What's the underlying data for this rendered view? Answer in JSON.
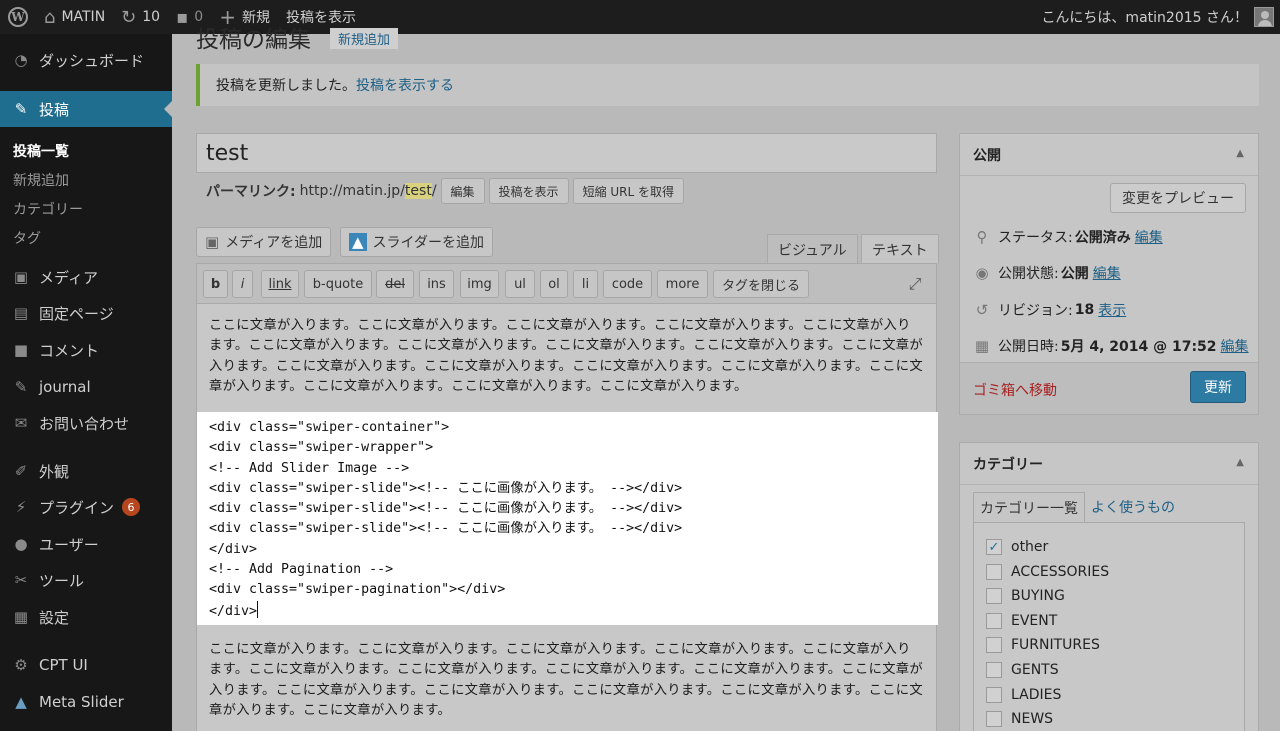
{
  "admin_bar": {
    "site_name": "MATIN",
    "updates_count": "10",
    "comments_count": "0",
    "new_label": "新規",
    "view_post_label": "投稿を表示",
    "greeting": "こんにちは、matin2015 さん！"
  },
  "sidebar": {
    "dashboard": "ダッシュボード",
    "posts": "投稿",
    "posts_sub": [
      "投稿一覧",
      "新規追加",
      "カテゴリー",
      "タグ"
    ],
    "media": "メディア",
    "pages": "固定ページ",
    "comments": "コメント",
    "journal": "journal",
    "contact": "お問い合わせ",
    "appearance": "外観",
    "plugins": "プラグイン",
    "plugins_badge": "6",
    "users": "ユーザー",
    "tools": "ツール",
    "settings": "設定",
    "cpt_ui": "CPT UI",
    "meta_slider": "Meta Slider"
  },
  "page": {
    "title": "投稿の編集",
    "add_new": "新規追加"
  },
  "notice": {
    "text": "投稿を更新しました。",
    "link": "投稿を表示する"
  },
  "editor": {
    "post_title": "test",
    "permalink_label": "パーマリンク:",
    "permalink_base": "http://matin.jp/",
    "permalink_slug": "test",
    "permalink_end": "/",
    "edit_btn": "編集",
    "view_btn": "投稿を表示",
    "shortlink_btn": "短縮 URL を取得",
    "add_media": "メディアを追加",
    "add_slider": "スライダーを追加",
    "tab_visual": "ビジュアル",
    "tab_text": "テキスト",
    "quicktags": [
      "b",
      "i",
      "link",
      "b-quote",
      "del",
      "ins",
      "img",
      "ul",
      "ol",
      "li",
      "code",
      "more",
      "タグを閉じる"
    ],
    "para1": "ここに文章が入ります。ここに文章が入ります。ここに文章が入ります。ここに文章が入ります。ここに文章が入ります。ここに文章が入ります。ここに文章が入ります。ここに文章が入ります。ここに文章が入ります。ここに文章が入ります。ここに文章が入ります。ここに文章が入ります。ここに文章が入ります。ここに文章が入ります。ここに文章が入ります。ここに文章が入ります。ここに文章が入ります。ここに文章が入ります。",
    "code_lines": [
      "<div class=\"swiper-container\">",
      "<div class=\"swiper-wrapper\">",
      "<!-- Add Slider Image -->",
      "<div class=\"swiper-slide\"><!-- ここに画像が入ります。 --></div>",
      "<div class=\"swiper-slide\"><!-- ここに画像が入ります。 --></div>",
      "<div class=\"swiper-slide\"><!-- ここに画像が入ります。 --></div>",
      "</div>",
      "<!-- Add Pagination -->",
      "<div class=\"swiper-pagination\"></div>",
      "</div>"
    ],
    "para2": "ここに文章が入ります。ここに文章が入ります。ここに文章が入ります。ここに文章が入ります。ここに文章が入ります。ここに文章が入ります。ここに文章が入ります。ここに文章が入ります。ここに文章が入ります。ここに文章が入ります。ここに文章が入ります。ここに文章が入ります。ここに文章が入ります。ここに文章が入ります。ここに文章が入ります。ここに文章が入ります。"
  },
  "publish": {
    "title": "公開",
    "preview_btn": "変更をプレビュー",
    "status_label": "ステータス:",
    "status_value": "公開済み",
    "visibility_label": "公開状態:",
    "visibility_value": "公開",
    "revision_label": "リビジョン:",
    "revision_value": "18",
    "revision_link": "表示",
    "date_label": "公開日時:",
    "date_value": "5月 4, 2014 @ 17:52",
    "edit_link": "編集",
    "trash_link": "ゴミ箱へ移動",
    "update_btn": "更新"
  },
  "categories": {
    "title": "カテゴリー",
    "tab_all": "カテゴリー一覧",
    "tab_popular": "よく使うもの",
    "items": [
      {
        "name": "other",
        "checked": true
      },
      {
        "name": "ACCESSORIES",
        "checked": false
      },
      {
        "name": "BUYING",
        "checked": false
      },
      {
        "name": "EVENT",
        "checked": false
      },
      {
        "name": "FURNITURES",
        "checked": false
      },
      {
        "name": "GENTS",
        "checked": false
      },
      {
        "name": "LADIES",
        "checked": false
      },
      {
        "name": "NEWS",
        "checked": false
      }
    ]
  },
  "colors": {
    "admin_bar": "#1d1d1d",
    "sidebar": "#171717",
    "current_menu": "#1f6e8f",
    "link": "#1e5f86",
    "update_button": "#2d7aa3",
    "trash": "#a82222",
    "notice_border": "#6ea332"
  },
  "icons": {
    "wp_logo": "wordpress-icon",
    "home": "home-icon",
    "updates": "refresh-icon",
    "comments": "comment-icon",
    "new": "plus-icon"
  }
}
